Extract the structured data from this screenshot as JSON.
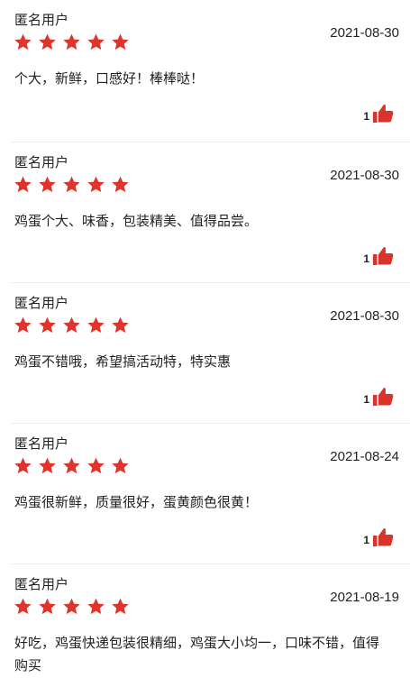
{
  "colors": {
    "star": "#e0342b",
    "thumb": "#d9342b",
    "text": "#222222",
    "divider": "#ececec"
  },
  "reviews": [
    {
      "reviewer": "匿名用户",
      "rating": 5,
      "date": "2021-08-30",
      "content": "个大，新鲜，口感好！棒棒哒！",
      "likes": "1"
    },
    {
      "reviewer": "匿名用户",
      "rating": 5,
      "date": "2021-08-30",
      "content": "鸡蛋个大、味香，包装精美、值得品尝。",
      "likes": "1"
    },
    {
      "reviewer": "匿名用户",
      "rating": 5,
      "date": "2021-08-30",
      "content": "鸡蛋不错哦，希望搞活动特，特实惠",
      "likes": "1"
    },
    {
      "reviewer": "匿名用户",
      "rating": 5,
      "date": "2021-08-24",
      "content": "鸡蛋很新鲜，质量很好，蛋黄颜色很黄！",
      "likes": "1"
    },
    {
      "reviewer": "匿名用户",
      "rating": 5,
      "date": "2021-08-19",
      "content": "好吃，鸡蛋快递包装很精细，鸡蛋大小均一，口味不错，值得购买",
      "likes": ""
    }
  ]
}
